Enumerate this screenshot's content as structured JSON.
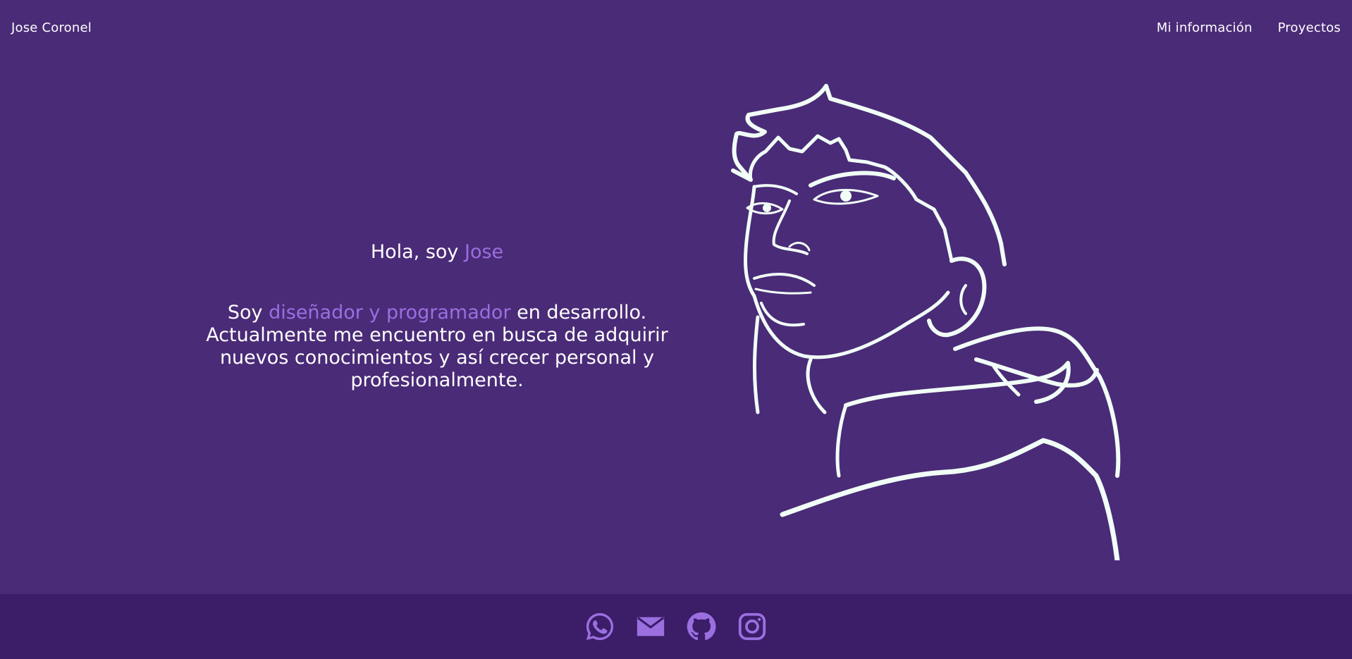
{
  "header": {
    "brand": "Jose Coronel",
    "nav": [
      {
        "label": "Mi información"
      },
      {
        "label": "Proyectos"
      }
    ]
  },
  "hero": {
    "greeting_prefix": "Hola, soy ",
    "greeting_name": "Jose",
    "bio_prefix": "Soy ",
    "bio_highlight": "diseñador y programador",
    "bio_rest": " en desarrollo. Actualmente me encuentro en busca de adquirir nuevos conocimientos y así crecer personal y profesionalmente."
  },
  "footer": {
    "socials": [
      {
        "icon": "whatsapp-icon"
      },
      {
        "icon": "mail-icon"
      },
      {
        "icon": "github-icon"
      },
      {
        "icon": "instagram-icon"
      }
    ]
  },
  "colors": {
    "background": "#4a2b77",
    "footer_background": "#3b1d68",
    "accent": "#9b6fe0",
    "text": "#ffffff",
    "line_art": "#f1fff7"
  }
}
